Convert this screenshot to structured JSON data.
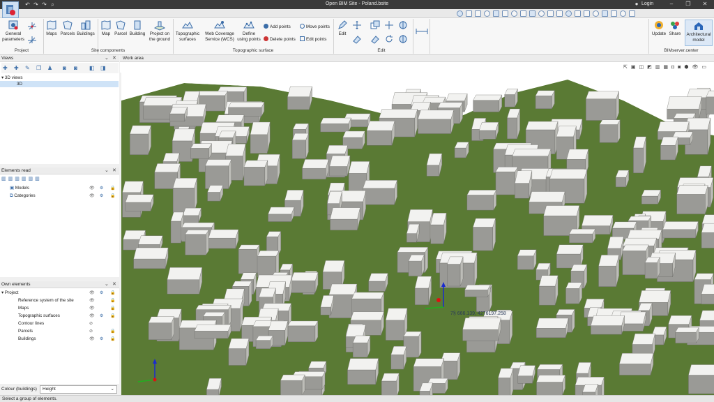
{
  "window": {
    "title": "Open BIM Site - Poland.bsite",
    "login_label": "Login"
  },
  "ribbon": {
    "project": {
      "group_label": "Project",
      "general_parameters": "General\nparameters"
    },
    "site_components": {
      "group_label": "Site components",
      "maps": "Maps",
      "parcels": "Parcels",
      "buildings": "Buildings",
      "map": "Map",
      "parcel": "Parcel",
      "building": "Building",
      "project_on_ground": "Project on\nthe ground"
    },
    "topographic_surface": {
      "group_label": "Topographic surface",
      "topographic_surfaces": "Topographic\nsurfaces",
      "wcs": "Web Coverage\nService (WCS)",
      "define_using_points": "Define\nusing points",
      "add_points": "Add points",
      "delete_points": "Delete points",
      "move_points": "Move points",
      "edit_points": "Edit points"
    },
    "edit": {
      "group_label": "Edit",
      "edit": "Edit"
    },
    "bimserver": {
      "group_label": "BIMserver.center",
      "update": "Update",
      "share": "Share",
      "architectural_model": "Architectural\nmodel"
    }
  },
  "panels": {
    "views": {
      "title": "Views",
      "tree_root": "3D views",
      "tree_item": "3D"
    },
    "elements_read": {
      "title": "Elements read",
      "items": [
        "Models",
        "Categories"
      ]
    },
    "own_elements": {
      "title": "Own elements",
      "root": "Project",
      "items": [
        "Reference system of the site",
        "Maps",
        "Topographic surfaces",
        "Contour lines",
        "Parcels",
        "Buildings"
      ]
    }
  },
  "work_area": {
    "title": "Work area",
    "coordinates": "7§ 666.139, 4276197.258"
  },
  "colour_buildings": {
    "label": "Colour (buildings)",
    "value": "Height"
  },
  "status": {
    "text": "Select a group of elements."
  },
  "colors": {
    "terrain": "#5a7a34",
    "building_top": "#f2f2f0",
    "building_side": "#9a9a96",
    "accent": "#1e6fc8",
    "titlebar": "#3a3a3a"
  }
}
